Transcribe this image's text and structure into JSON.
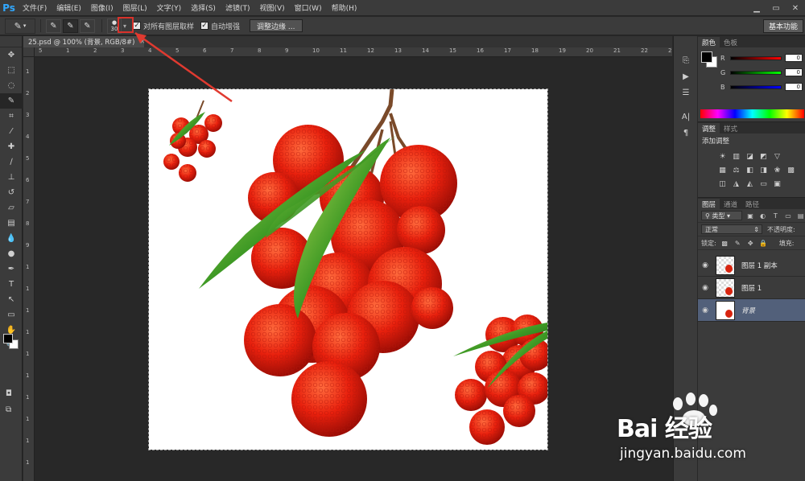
{
  "app": {
    "logo": "Ps"
  },
  "menu": [
    "文件(F)",
    "编辑(E)",
    "图像(I)",
    "图层(L)",
    "文字(Y)",
    "选择(S)",
    "滤镜(T)",
    "视图(V)",
    "窗口(W)",
    "帮助(H)"
  ],
  "options": {
    "brush_size": "30",
    "sample_all_layers_label": "对所有图层取样",
    "sample_all_layers_checked": true,
    "auto_enhance_label": "自动增强",
    "auto_enhance_checked": true,
    "refine_edge_label": "调整边缘 ...",
    "workspace_label": "基本功能"
  },
  "document": {
    "tab_title": "25.psd @ 100% (背景, RGB/8#)",
    "ruler_top": [
      "5",
      "1",
      "2",
      "3",
      "4",
      "5",
      "6",
      "7",
      "8",
      "9",
      "10",
      "11",
      "12",
      "13",
      "14",
      "15",
      "16",
      "17",
      "18",
      "19",
      "20",
      "21",
      "22",
      "23"
    ],
    "ruler_left": [
      "1",
      "2",
      "3",
      "4",
      "5",
      "6",
      "7",
      "8",
      "9",
      "1",
      "1",
      "1",
      "1",
      "1",
      "1",
      "1",
      "1",
      "1",
      "1"
    ]
  },
  "color_panel": {
    "tabs": [
      "颜色",
      "色板"
    ],
    "sliders": [
      {
        "label": "R",
        "value": "0",
        "color": "#ff0000"
      },
      {
        "label": "G",
        "value": "0",
        "color": "#00ff00"
      },
      {
        "label": "B",
        "value": "0",
        "color": "#0000ff"
      }
    ]
  },
  "adjustments_panel": {
    "tabs": [
      "调整",
      "样式"
    ],
    "title": "添加调整"
  },
  "layers_panel": {
    "tabs": [
      "图层",
      "通道",
      "路径"
    ],
    "filter_kind": "类型",
    "blend_mode": "正常",
    "opacity_label": "不透明度:",
    "lock_label": "锁定:",
    "fill_label": "填充:",
    "layers": [
      {
        "name": "图层 1 副本",
        "selected": false,
        "italic": false
      },
      {
        "name": "图层 1",
        "selected": false,
        "italic": false
      },
      {
        "name": "背景",
        "selected": true,
        "italic": true
      }
    ]
  },
  "watermark": {
    "brand": "Bai 经验",
    "url": "jingyan.baidu.com"
  }
}
